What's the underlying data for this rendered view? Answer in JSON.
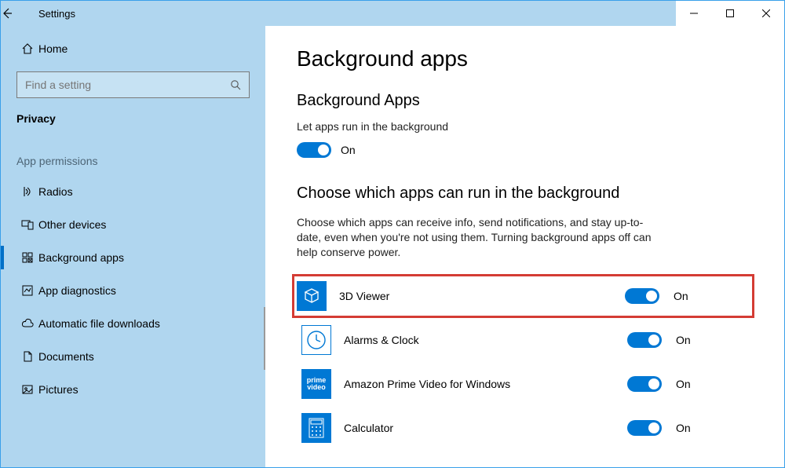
{
  "window": {
    "title": "Settings"
  },
  "sidebar": {
    "home_label": "Home",
    "search_placeholder": "Find a setting",
    "privacy_label": "Privacy",
    "section_label": "App permissions",
    "items": [
      {
        "label": "Radios",
        "icon": "radios"
      },
      {
        "label": "Other devices",
        "icon": "devices"
      },
      {
        "label": "Background apps",
        "icon": "grid",
        "active": true
      },
      {
        "label": "App diagnostics",
        "icon": "chart"
      },
      {
        "label": "Automatic file downloads",
        "icon": "cloud"
      },
      {
        "label": "Documents",
        "icon": "document"
      },
      {
        "label": "Pictures",
        "icon": "picture"
      }
    ]
  },
  "main": {
    "page_title": "Background apps",
    "section1_title": "Background Apps",
    "section1_desc": "Let apps run in the background",
    "section1_toggle": {
      "state": "On"
    },
    "section2_title": "Choose which apps can run in the background",
    "section2_desc": "Choose which apps can receive info, send notifications, and stay up-to-date, even when you're not using them. Turning background apps off can help conserve power.",
    "apps": [
      {
        "name": "3D Viewer",
        "icon": "cube",
        "state": "On",
        "highlighted": true
      },
      {
        "name": "Alarms & Clock",
        "icon": "clock",
        "state": "On"
      },
      {
        "name": "Amazon Prime Video for Windows",
        "icon": "prime",
        "state": "On"
      },
      {
        "name": "Calculator",
        "icon": "calculator",
        "state": "On"
      }
    ]
  }
}
